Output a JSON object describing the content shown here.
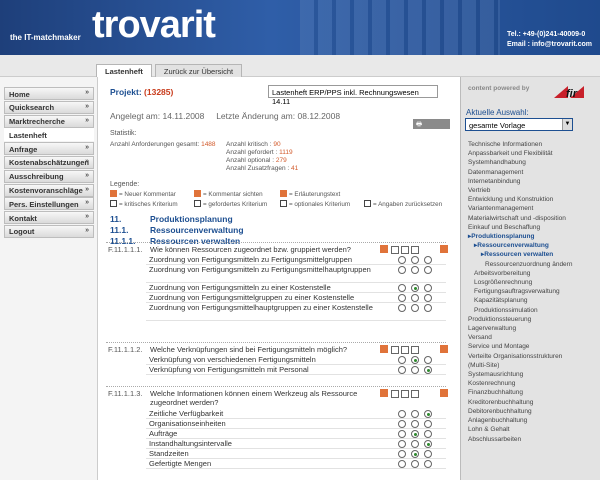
{
  "header": {
    "tagline": "the IT-matchmaker",
    "logo": "trovarit",
    "phone": "Tel.: +49-(0)241-40009-0",
    "email": "Email : info@trovarit.com"
  },
  "tabs": [
    {
      "label": "Lastenheft",
      "active": true
    },
    {
      "label": "Zurück zur Übersicht",
      "active": false
    }
  ],
  "sidebar": {
    "items": [
      {
        "label": "Home",
        "arrow": "»",
        "active": false
      },
      {
        "label": "Quicksearch",
        "arrow": "»",
        "active": false
      },
      {
        "label": "Marktrecherche",
        "arrow": "»",
        "active": false
      },
      {
        "label": "Lastenheft",
        "arrow": "",
        "active": true
      },
      {
        "label": "Anfrage",
        "arrow": "»",
        "active": false
      },
      {
        "label": "Kostenabschätzungen",
        "arrow": "»",
        "active": false
      },
      {
        "label": "Ausschreibung",
        "arrow": "»",
        "active": false
      },
      {
        "label": "Kostenvoranschläge",
        "arrow": "»",
        "active": false
      },
      {
        "label": "Pers. Einstellungen",
        "arrow": "»",
        "active": false
      },
      {
        "label": "Kontakt",
        "arrow": "»",
        "active": false
      },
      {
        "label": "Logout",
        "arrow": "»",
        "active": false
      }
    ]
  },
  "project": {
    "label": "Projekt:",
    "number": "(13285)",
    "name": "Lastenheft ERP/PPS inkl. Rechnungswesen 14.11"
  },
  "dates": {
    "created_label": "Angelegt am:",
    "created": "14.11.2008",
    "changed_label": "Letzte Änderung am:",
    "changed": "08.12.2008"
  },
  "print_label": "drucken",
  "statistics": {
    "title": "Statistik:",
    "total_label": "Anzahl Anforderungen gesamt:",
    "total": "1488",
    "critical_label": "Anzahl kritisch :",
    "critical": "90",
    "required_label": "Anzahl gefordert :",
    "required": "1119",
    "optional_label": "Anzahl optional :",
    "optional": "279",
    "extra_label": "Anzahl Zusatzfragen :",
    "extra": "41"
  },
  "legend": {
    "title": "Legende:",
    "items": [
      "= Neuer Kommentar",
      "= Kommentar sichten",
      "= Erläuterungstext",
      "= kritisches Kriterium",
      "= gefordertes Kriterium",
      "= optionales Kriterium",
      "= Angaben zurücksetzen"
    ]
  },
  "sections": [
    {
      "num": "11.",
      "title": "Produktionsplanung"
    },
    {
      "num": "11.1.",
      "title": "Ressourcenverwaltung"
    },
    {
      "num": "11.1.1.",
      "title": "Ressourcen verwalten"
    }
  ],
  "questions": [
    {
      "code": "F.11.1.1.1.",
      "text": "Wie können Ressourcen zugeordnet bzw. gruppiert werden?",
      "rows": [
        {
          "label": "Zuordnung von Fertigungsmitteln zu Fertigungsmittelgruppen",
          "selected": -1
        },
        {
          "label": "Zuordnung von Fertigungsmitteln zu Fertigungsmittelhauptgruppen",
          "selected": -1
        },
        {
          "label": "Zuordnung von Fertigungsmitteln zu einer Kostenstelle",
          "selected": 1
        },
        {
          "label": "Zuordnung von Fertigungsmittelgruppen zu einer Kostenstelle",
          "selected": -1
        },
        {
          "label": "Zuordnung von Fertigungsmittelhauptgruppen zu einer Kostenstelle",
          "selected": -1
        }
      ]
    },
    {
      "code": "F.11.1.1.2.",
      "text": "Welche Verknüpfungen sind bei Fertigungsmitteln möglich?",
      "rows": [
        {
          "label": "Verknüpfung von verschiedenen Fertigungsmitteln",
          "selected": 1
        },
        {
          "label": "Verknüpfung von Fertigungsmitteln mit Personal",
          "selected": 2
        }
      ]
    },
    {
      "code": "F.11.1.1.3.",
      "text": "Welche Informationen können einem Werkzeug als Ressource zugeordnet werden?",
      "rows": [
        {
          "label": "Zeitliche Verfügbarkeit",
          "selected": 2
        },
        {
          "label": "Organisationseinheiten",
          "selected": -1
        },
        {
          "label": "Aufträge",
          "selected": 1
        },
        {
          "label": "Instandhaltungsintervalle",
          "selected": 2
        },
        {
          "label": "Standzeiten",
          "selected": 1
        },
        {
          "label": "Gefertigte Mengen",
          "selected": -1
        }
      ]
    }
  ],
  "right": {
    "powered_by": "content powered by",
    "fir_logo": "fir",
    "selection_label": "Aktuelle Auswahl:",
    "selection_value": "gesamte Vorlage",
    "tree": [
      {
        "label": "Technische Informationen",
        "level": 0,
        "selected": false
      },
      {
        "label": "Anpassbarkeit und Flexibilität",
        "level": 0,
        "selected": false
      },
      {
        "label": "Systemhandhabung",
        "level": 0,
        "selected": false
      },
      {
        "label": "Datenmanagement",
        "level": 0,
        "selected": false
      },
      {
        "label": "Internetanbindung",
        "level": 0,
        "selected": false
      },
      {
        "label": "Vertrieb",
        "level": 0,
        "selected": false
      },
      {
        "label": "Entwicklung und Konstruktion",
        "level": 0,
        "selected": false
      },
      {
        "label": "Variantenmanagement",
        "level": 0,
        "selected": false
      },
      {
        "label": "Materialwirtschaft und -disposition",
        "level": 0,
        "selected": false
      },
      {
        "label": "Einkauf und Beschaffung",
        "level": 0,
        "selected": false
      },
      {
        "label": "▸Produktionsplanung",
        "level": 0,
        "selected": true
      },
      {
        "label": "▸Ressourcenverwaltung",
        "level": 1,
        "selected": true
      },
      {
        "label": "▸Ressourcen verwalten",
        "level": 2,
        "selected": true
      },
      {
        "label": "Ressourcenzuordnung ändern",
        "level": 3,
        "selected": false
      },
      {
        "label": "Arbeitsvorbereitung",
        "level": 1,
        "selected": false
      },
      {
        "label": "Losgrößenrechnung",
        "level": 1,
        "selected": false
      },
      {
        "label": "Fertigungsauftragsverwaltung",
        "level": 1,
        "selected": false
      },
      {
        "label": "Kapazitätsplanung",
        "level": 1,
        "selected": false
      },
      {
        "label": "Produktionssimulation",
        "level": 1,
        "selected": false
      },
      {
        "label": "Produktionssteuerung",
        "level": 0,
        "selected": false
      },
      {
        "label": "Lagerverwaltung",
        "level": 0,
        "selected": false
      },
      {
        "label": "Versand",
        "level": 0,
        "selected": false
      },
      {
        "label": "Service und Montage",
        "level": 0,
        "selected": false
      },
      {
        "label": "Verteilte Organisationsstrukturen",
        "level": 0,
        "selected": false
      },
      {
        "label": "(Multi-Site)",
        "level": 0,
        "selected": false
      },
      {
        "label": "Systemausrichtung",
        "level": 0,
        "selected": false
      },
      {
        "label": "Kostenrechnung",
        "level": 0,
        "selected": false
      },
      {
        "label": "Finanzbuchhaltung",
        "level": 0,
        "selected": false
      },
      {
        "label": "Kreditorenbuchhaltung",
        "level": 0,
        "selected": false
      },
      {
        "label": "Debitorenbuchhaltung",
        "level": 0,
        "selected": false
      },
      {
        "label": "Anlagenbuchhaltung",
        "level": 0,
        "selected": false
      },
      {
        "label": "Lohn & Gehalt",
        "level": 0,
        "selected": false
      },
      {
        "label": "Abschlussarbeiten",
        "level": 0,
        "selected": false
      }
    ]
  },
  "colors": {
    "header_blue": "#2f5ea8",
    "link_blue": "#1d4f91",
    "accent_orange": "#e0733a",
    "selected_green": "#2d8a2d"
  }
}
